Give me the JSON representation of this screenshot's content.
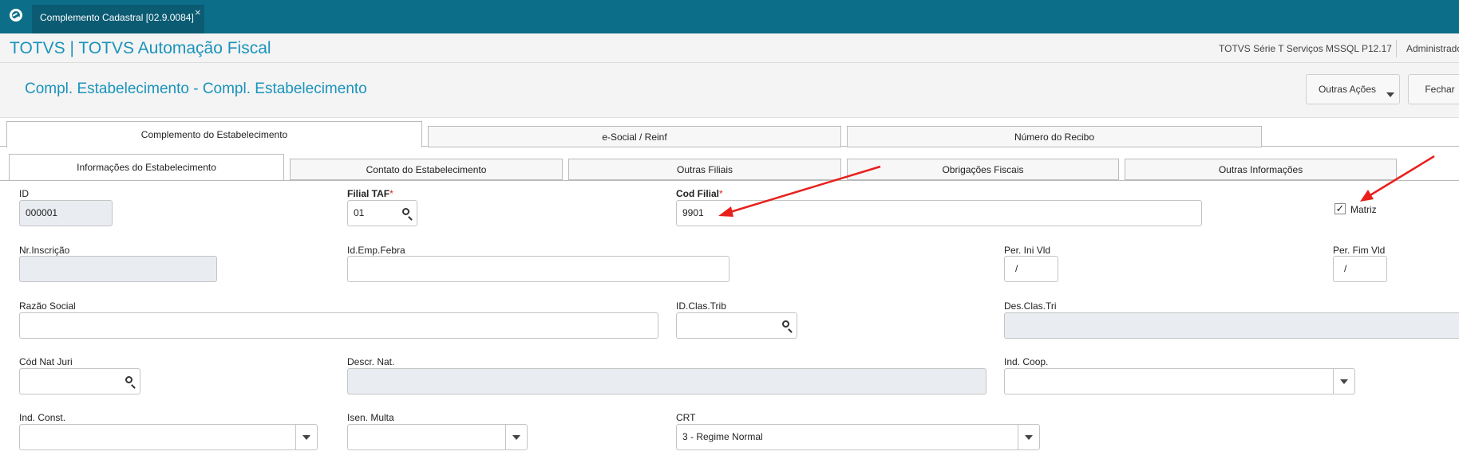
{
  "window": {
    "tab_title": "Complemento Cadastral [02.9.0084]",
    "tab_close": "×"
  },
  "header": {
    "app_title": "TOTVS | TOTVS Automação Fiscal",
    "environment": "TOTVS Série T Serviços MSSQL P12.17",
    "user": "Administrado"
  },
  "page": {
    "title": "Compl. Estabelecimento - Compl. Estabelecimento",
    "btn_outras_acoes": "Outras Ações",
    "btn_fechar": "Fechar"
  },
  "tabs_main": [
    {
      "label": "Complemento do Estabelecimento",
      "active": true
    },
    {
      "label": "e-Social / Reinf",
      "active": false
    },
    {
      "label": "Número do Recibo",
      "active": false
    }
  ],
  "tabs_sub": [
    {
      "label": "Informações do Estabelecimento",
      "active": true
    },
    {
      "label": "Contato do Estabelecimento",
      "active": false
    },
    {
      "label": "Outras Filiais",
      "active": false
    },
    {
      "label": "Obrigações Fiscais",
      "active": false
    },
    {
      "label": "Outras Informações",
      "active": false
    }
  ],
  "fields": {
    "id": {
      "label": "ID",
      "value": "000001"
    },
    "filial_taf": {
      "label": "Filial TAF",
      "required": "*",
      "value": "01"
    },
    "cod_filial": {
      "label": "Cod Filial",
      "required": "*",
      "value": "9901"
    },
    "matriz": {
      "label": "Matriz",
      "checked": true,
      "mark": "✓"
    },
    "nr_inscricao": {
      "label": "Nr.Inscrição",
      "value": ""
    },
    "id_emp_febra": {
      "label": "Id.Emp.Febra",
      "value": ""
    },
    "per_ini_vld": {
      "label": "Per. Ini Vld",
      "value": "/"
    },
    "per_fim_vld": {
      "label": "Per. Fim Vld",
      "value": "/"
    },
    "razao_social": {
      "label": "Razão Social",
      "value": ""
    },
    "id_clas_trib": {
      "label": "ID.Clas.Trib",
      "value": ""
    },
    "des_clas_tri": {
      "label": "Des.Clas.Tri",
      "value": ""
    },
    "cod_nat_juri": {
      "label": "Cód Nat Juri",
      "value": ""
    },
    "descr_nat": {
      "label": "Descr. Nat.",
      "value": ""
    },
    "ind_coop": {
      "label": "Ind. Coop.",
      "value": ""
    },
    "ind_const": {
      "label": "Ind. Const.",
      "value": ""
    },
    "isen_multa": {
      "label": "Isen. Multa",
      "value": ""
    },
    "crt": {
      "label": "CRT",
      "value": "3 - Regime Normal"
    }
  },
  "colors": {
    "topbar": "#0d6e8a",
    "title_text": "#1a93bb",
    "required": "#d9262c",
    "annotation_arrow": "#e8201c"
  }
}
